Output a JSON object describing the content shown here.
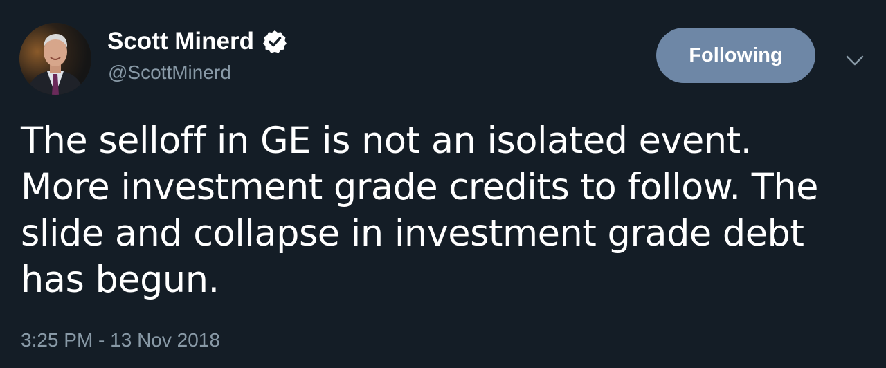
{
  "user": {
    "display_name": "Scott Minerd",
    "handle": "@ScottMinerd",
    "verified_icon": "verified-badge-icon"
  },
  "follow_button": {
    "label": "Following"
  },
  "menu": {
    "caret_icon": "chevron-down-icon"
  },
  "tweet": {
    "text_lines": [
      "The selloff in GE is not an isolated event.",
      "More investment grade credits to follow. The",
      "slide and collapse in investment grade debt",
      "has begun."
    ],
    "timestamp": "3:25 PM - 13 Nov 2018"
  },
  "colors": {
    "background": "#141d26",
    "text": "#ffffff",
    "secondary_text": "#8899a6",
    "button": "#6e87a6"
  }
}
